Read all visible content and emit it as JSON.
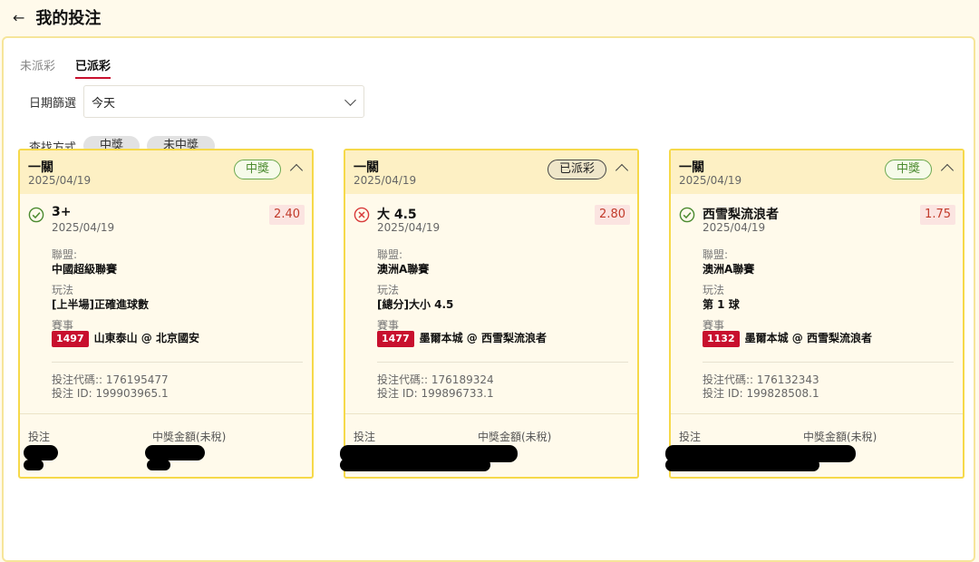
{
  "header": {
    "back_icon": "←",
    "title": "我的投注"
  },
  "tabs": [
    {
      "label": "未派彩",
      "active": false
    },
    {
      "label": "已派彩",
      "active": true
    }
  ],
  "date_filter": {
    "label": "日期篩選",
    "value": "今天"
  },
  "search": {
    "label": "查找方式",
    "options": [
      "中獎",
      "未中獎"
    ]
  },
  "colors": {
    "accent": "#c8102e",
    "card_border": "#f6d94a",
    "win": "#4a8a2f",
    "lose": "#d83a3a"
  },
  "cards": [
    {
      "round": "一關",
      "date": "2025/04/19",
      "status": "中獎",
      "status_type": "win",
      "result_icon": "check-circle-icon",
      "selection": "3+",
      "selection_date": "2025/04/19",
      "odds": "2.40",
      "league_label": "聯盟:",
      "league": "中國超級聯賽",
      "play_label": "玩法",
      "play": "[上半場]正確進球數",
      "event_label": "賽事",
      "event_no": "1497",
      "event": "山東泰山 @ 北京國安",
      "bet_code_text": "投注代碼:: 176195477",
      "bet_id_text": "投注 ID: 199903965.1",
      "stake_label": "投注",
      "payout_label": "中獎金額(未稅)"
    },
    {
      "round": "一關",
      "date": "2025/04/19",
      "status": "已派彩",
      "status_type": "paid",
      "result_icon": "cross-circle-icon",
      "selection": "大 4.5",
      "selection_date": "2025/04/19",
      "odds": "2.80",
      "league_label": "聯盟:",
      "league": "澳洲A聯賽",
      "play_label": "玩法",
      "play": "[總分]大小 4.5",
      "event_label": "賽事",
      "event_no": "1477",
      "event": "墨爾本城 @ 西雪梨流浪者",
      "bet_code_text": "投注代碼:: 176189324",
      "bet_id_text": "投注 ID: 199896733.1",
      "stake_label": "投注",
      "payout_label": "中獎金額(未稅)"
    },
    {
      "round": "一關",
      "date": "2025/04/19",
      "status": "中獎",
      "status_type": "win",
      "result_icon": "check-circle-icon",
      "selection": "西雪梨流浪者",
      "selection_date": "2025/04/19",
      "odds": "1.75",
      "league_label": "聯盟:",
      "league": "澳洲A聯賽",
      "play_label": "玩法",
      "play": "第 1 球",
      "event_label": "賽事",
      "event_no": "1132",
      "event": "墨爾本城 @ 西雪梨流浪者",
      "bet_code_text": "投注代碼:: 176132343",
      "bet_id_text": "投注 ID: 199828508.1",
      "stake_label": "投注",
      "payout_label": "中獎金額(未稅)"
    }
  ]
}
